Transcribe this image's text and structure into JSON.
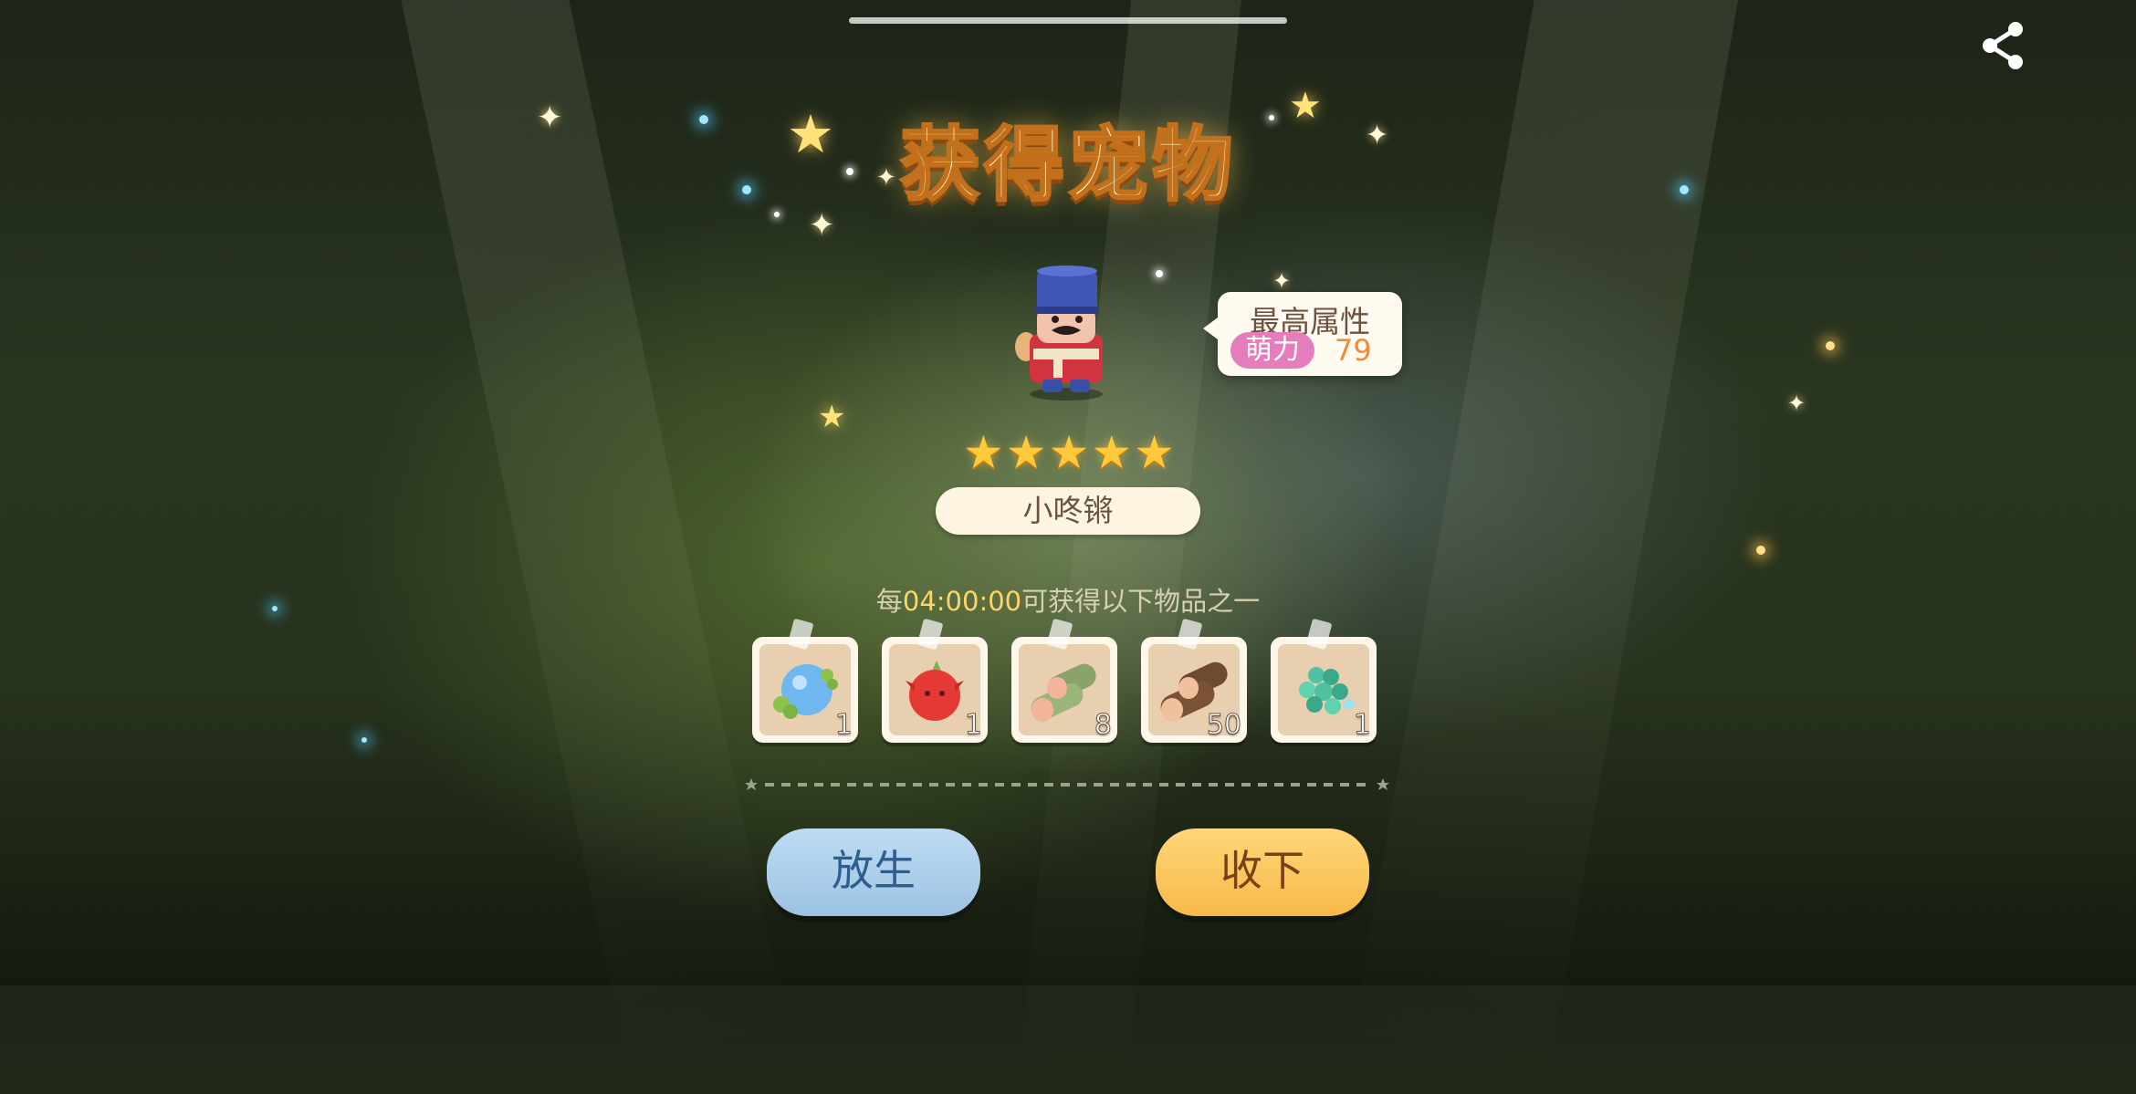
{
  "title": "获得宠物",
  "pet": {
    "name": "小咚锵",
    "star_rating": 5,
    "attribute_title": "最高属性",
    "attribute_name": "萌力",
    "attribute_value": "79"
  },
  "timer_text": {
    "prefix": "每",
    "time": "04:00:00",
    "suffix": "可获得以下物品之一"
  },
  "rewards": [
    {
      "icon": "blue-slime-fruit-icon",
      "count": "1"
    },
    {
      "icon": "red-dragonfruit-icon",
      "count": "1"
    },
    {
      "icon": "green-log-icon",
      "count": "8"
    },
    {
      "icon": "brown-log-icon",
      "count": "50"
    },
    {
      "icon": "teal-gem-cluster-icon",
      "count": "1"
    }
  ],
  "buttons": {
    "release_label": "放生",
    "accept_label": "收下"
  },
  "icons": {
    "share": "share-icon"
  },
  "colors": {
    "attribute_pill": "#e57dbc",
    "attribute_value": "#f08b36",
    "timer_highlight": "#ffd56a",
    "release_button": "#a9cdea",
    "accept_button": "#f9c65e"
  }
}
